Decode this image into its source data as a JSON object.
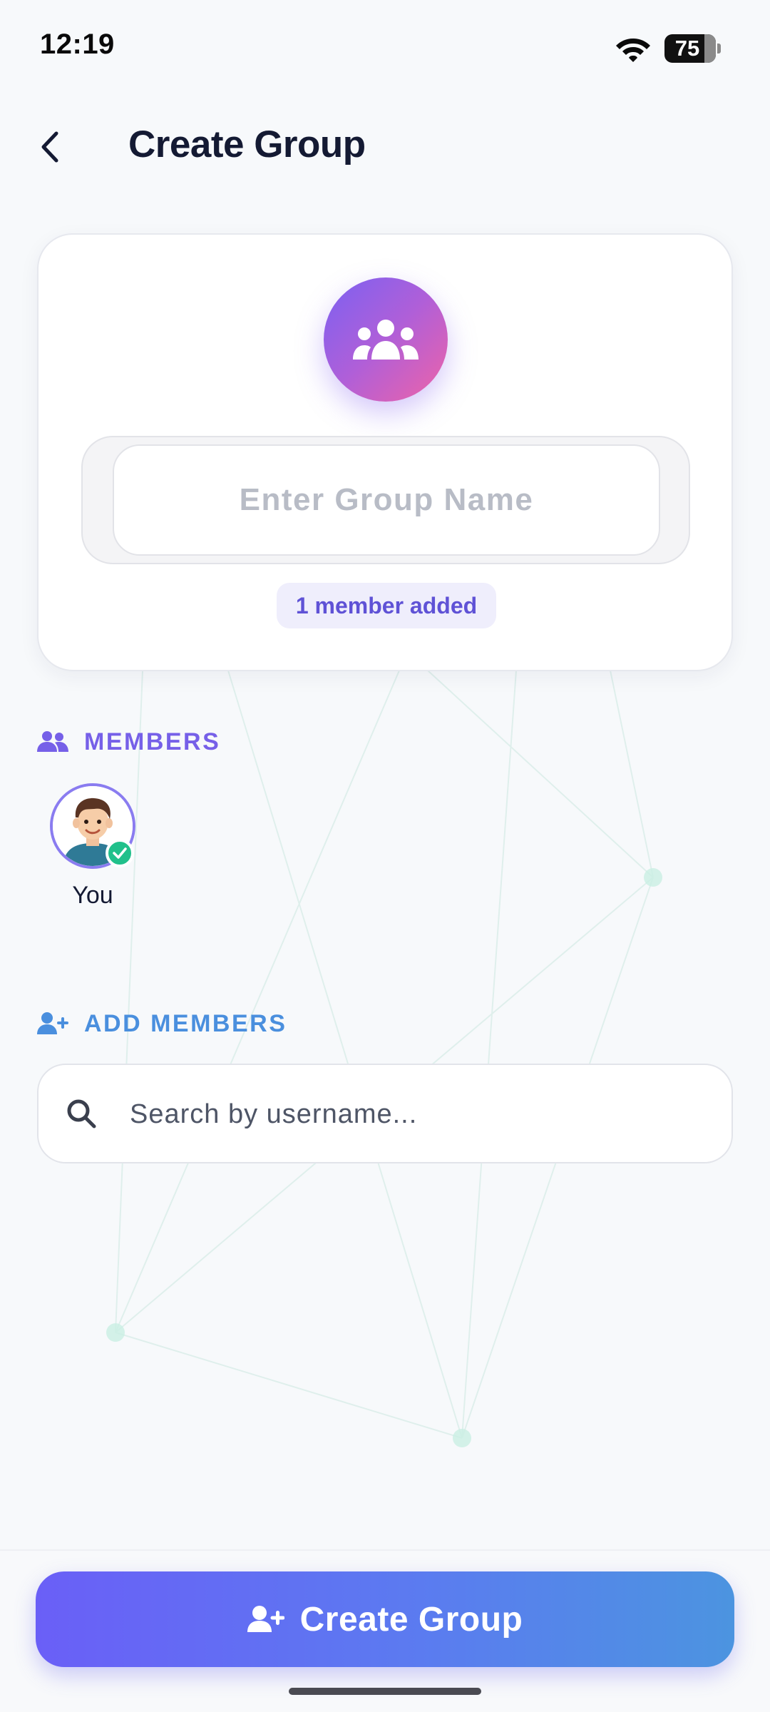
{
  "status_bar": {
    "time": "12:19",
    "battery_level": "75",
    "wifi_icon": "wifi-icon"
  },
  "header": {
    "back_icon": "chevron-left-icon",
    "title": "Create Group"
  },
  "group_card": {
    "avatar_icon": "group-icon",
    "name_placeholder": "Enter Group Name",
    "name_value": "",
    "member_count_text": "1 member added"
  },
  "members_section": {
    "icon": "group-icon",
    "title": "MEMBERS",
    "members": [
      {
        "name": "You",
        "avatar": "avatar-icon",
        "selected": true
      }
    ]
  },
  "add_members_section": {
    "icon": "user-plus-icon",
    "title": "ADD MEMBERS",
    "search_icon": "search-icon",
    "search_placeholder": "Search by username...",
    "search_value": ""
  },
  "footer": {
    "create_button_icon": "user-plus-icon",
    "create_button_label": "Create Group"
  },
  "colors": {
    "accent_purple": "#7660e8",
    "accent_blue": "#4a8fde",
    "success_green": "#21c08b",
    "title_dark": "#141a33",
    "background": "#f7f9fb"
  }
}
